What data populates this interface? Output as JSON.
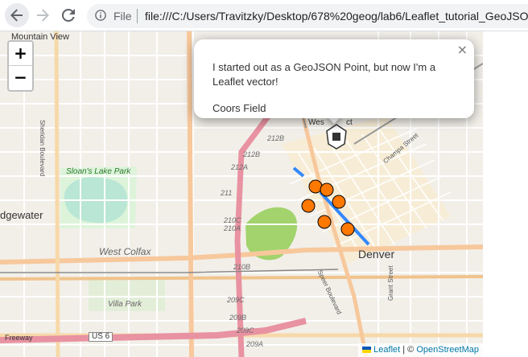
{
  "browser": {
    "file_label": "File",
    "url": "file:///C:/Users/Travitzky/Desktop/678%20geog/lab6/Leaflet_tutorial_GeoJSON"
  },
  "map": {
    "labels": {
      "mountain_view": "Mountain View",
      "sloans_lake_park": "Sloan's Lake Park",
      "edgewater": "dgewater",
      "west_colfax": "West Colfax",
      "denver": "Denver",
      "villa_park": "Villa Park",
      "sheridan_blvd": "Sheridan Boulevard",
      "speer_blvd": "Speer Boulevard",
      "champa_street": "Champa Street",
      "grant_street": "Grant Street",
      "freeway": "Freeway",
      "us6": "US 6",
      "west_partial": "Wes",
      "ct_partial": "ct"
    },
    "routes": [
      "212B",
      "212B",
      "212A",
      "211",
      "210C",
      "210A",
      "210B",
      "209C",
      "209B",
      "209C",
      "209A"
    ]
  },
  "zoom": {
    "in": "+",
    "out": "−"
  },
  "popup": {
    "text": "I started out as a GeoJSON Point, but now I'm a Leaflet vector!",
    "name": "Coors Field",
    "close": "×"
  },
  "attribution": {
    "leaflet": "Leaflet",
    "separator": " | © ",
    "osm": "OpenStreetMap"
  }
}
